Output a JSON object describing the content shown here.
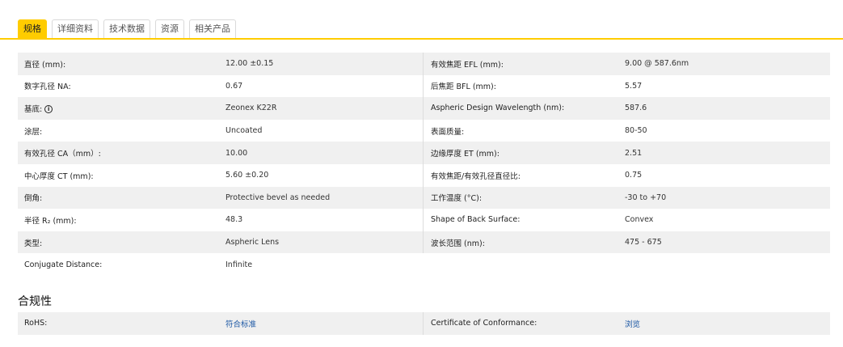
{
  "tabs": [
    "规格",
    "详细资料",
    "技术数据",
    "资源",
    "相关产品"
  ],
  "active_tab": "规格",
  "specs": [
    {
      "l_label": "直径 (mm):",
      "l_value": "12.00 ±0.15",
      "r_label": "有效焦距 EFL (mm):",
      "r_value": "9.00 @ 587.6nm"
    },
    {
      "l_label": "数字孔径 NA:",
      "l_value": "0.67",
      "r_label": "后焦距 BFL (mm):",
      "r_value": "5.57"
    },
    {
      "l_label": "基底:",
      "l_value": "Zeonex K22R",
      "r_label": "Aspheric Design Wavelength (nm):",
      "r_value": "587.6"
    },
    {
      "l_label": "涂层:",
      "l_value": "Uncoated",
      "r_label": "表面质量:",
      "r_value": "80-50"
    },
    {
      "l_label": "有效孔径 CA（mm）:",
      "l_value": "10.00",
      "r_label": "边缘厚度 ET (mm):",
      "r_value": "2.51"
    },
    {
      "l_label": "中心厚度 CT (mm):",
      "l_value": "5.60 ±0.20",
      "r_label": "有效焦距/有效孔径直径比:",
      "r_value": "0.75"
    },
    {
      "l_label": "倒角:",
      "l_value": "Protective bevel as needed",
      "r_label": "工作温度 (°C):",
      "r_value": "-30 to +70"
    },
    {
      "l_label": "半径 R₂ (mm):",
      "l_value": "48.3",
      "r_label": "Shape of Back Surface:",
      "r_value": "Convex"
    },
    {
      "l_label": "类型:",
      "l_value": "Aspheric Lens",
      "r_label": "波长范围 (nm):",
      "r_value": "475 - 675"
    },
    {
      "l_label": "Conjugate Distance:",
      "l_value": "Infinite",
      "r_label": "",
      "r_value": ""
    }
  ],
  "compliance": {
    "title": "合规性",
    "l_label": "RoHS:",
    "l_value": "符合标准",
    "r_label": "Certificate of Conformance:",
    "r_value": "浏览"
  },
  "colors": {
    "accent": "#ffcc00",
    "link": "#1a56a3",
    "row_shade": "#f0f0f0"
  }
}
